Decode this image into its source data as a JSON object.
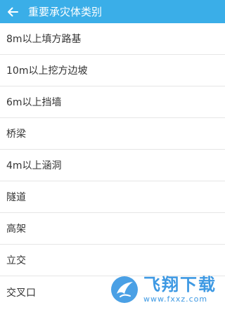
{
  "header": {
    "title": "重要承灾体类别",
    "back_icon": "arrow-left-icon"
  },
  "colors": {
    "header_bg": "#3aaee8",
    "header_text": "#ffffff",
    "list_bg": "#ffffff",
    "divider": "#e6e6e6",
    "text": "#333333",
    "watermark": "#2a8fe0"
  },
  "list": {
    "items": [
      {
        "label": "8m以上填方路基"
      },
      {
        "label": "10m以上挖方边坡"
      },
      {
        "label": "6m以上挡墙"
      },
      {
        "label": "桥梁"
      },
      {
        "label": "4m以上涵洞"
      },
      {
        "label": "隧道"
      },
      {
        "label": "高架"
      },
      {
        "label": "立交"
      },
      {
        "label": "交叉口"
      }
    ]
  },
  "watermark": {
    "text": "飞翔下载",
    "url": "www.fxxz.com"
  }
}
